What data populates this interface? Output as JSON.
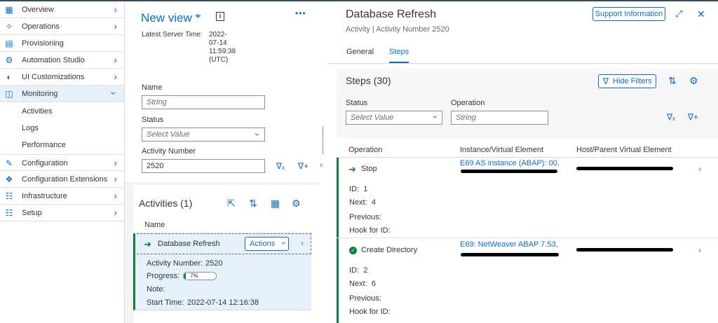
{
  "sidebar": {
    "items": [
      {
        "label": "Overview",
        "icon": "grid-icon",
        "expandable": true
      },
      {
        "label": "Operations",
        "icon": "network-icon",
        "expandable": true
      },
      {
        "label": "Provisioning",
        "icon": "provisioning-icon",
        "expandable": false
      },
      {
        "label": "Automation Studio",
        "icon": "wrench-icon",
        "expandable": true
      },
      {
        "label": "UI Customizations",
        "icon": "palette-icon",
        "expandable": true
      },
      {
        "label": "Monitoring",
        "icon": "monitor-icon",
        "expandable": true,
        "active": true
      },
      {
        "label": "Configuration",
        "icon": "config-icon",
        "expandable": true
      },
      {
        "label": "Configuration Extensions",
        "icon": "extension-icon",
        "expandable": true
      },
      {
        "label": "Infrastructure",
        "icon": "hierarchy-icon",
        "expandable": true
      },
      {
        "label": "Setup",
        "icon": "setup-icon",
        "expandable": true
      }
    ],
    "monitoring_children": [
      "Activities",
      "Logs",
      "Performance"
    ]
  },
  "view": {
    "title": "New view *",
    "latest_server_time_label": "Latest Server Time:",
    "latest_server_time_value": "2022-07-14 11:59:38 (UTC)"
  },
  "filters": {
    "name_label": "Name",
    "name_placeholder": "String",
    "status_label": "Status",
    "status_placeholder": "Select Value",
    "activity_number_label": "Activity Number",
    "activity_number_value": "2520"
  },
  "activities": {
    "title": "Activities (1)",
    "column_name": "Name",
    "row": {
      "name": "Database Refresh",
      "actions_label": "Actions",
      "activity_number_label": "Activity Number:",
      "activity_number": "2520",
      "progress_label": "Progress:",
      "progress": 7,
      "progress_text": "7%",
      "note_label": "Note:",
      "start_time_label": "Start Time:",
      "start_time": "2022-07-14 12:16:38"
    }
  },
  "detail": {
    "title": "Database Refresh",
    "subtitle": "Activity | Activity Number 2520",
    "support_button": "Support Information",
    "tabs": [
      {
        "label": "General",
        "selected": false
      },
      {
        "label": "Steps",
        "selected": true
      }
    ],
    "steps_title": "Steps (30)",
    "hide_filters_label": "Hide Filters",
    "status_label": "Status",
    "status_placeholder": "Select Value",
    "operation_label": "Operation",
    "operation_placeholder": "String",
    "columns": [
      "Operation",
      "Instance/Virtual Element",
      "Host/Parent Virtual Element"
    ],
    "steps": [
      {
        "operation": "Stop",
        "instance": "E69 AS instance (ABAP): 00,",
        "id_label": "ID:",
        "id": "1",
        "next_label": "Next:",
        "next": "4",
        "previous_label": "Previous:",
        "hook_label": "Hook for ID:"
      },
      {
        "operation": "Create Directory",
        "instance": "E69: NetWeaver ABAP 7.53,",
        "id_label": "ID:",
        "id": "2",
        "next_label": "Next:",
        "next": "6",
        "previous_label": "Previous:",
        "hook_label": "Hook for ID:"
      }
    ]
  },
  "colors": {
    "accent": "#0a6ed1",
    "positive": "#107e3e",
    "selected_bg": "#e5f0fa"
  }
}
